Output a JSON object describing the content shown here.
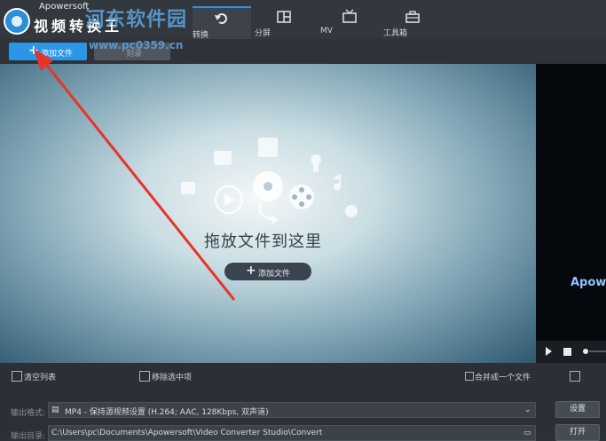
{
  "header": {
    "brand": "Apowersoft",
    "app_title": "视频转换王",
    "watermark_title": "河东软件园",
    "watermark_url": "www.pc0359.cn"
  },
  "tabs": [
    {
      "label": "转换",
      "icon": "refresh-icon",
      "active": true
    },
    {
      "label": "分屏",
      "icon": "split-screen-icon",
      "active": false
    },
    {
      "label": "MV",
      "icon": "tv-icon",
      "active": false
    },
    {
      "label": "工具箱",
      "icon": "toolbox-icon",
      "active": false
    }
  ],
  "toolbar": {
    "add_file": "添加文件",
    "add_file_secondary": "刻录"
  },
  "dropzone": {
    "hint": "拖放文件到这里",
    "add_file": "添加文件"
  },
  "preview": {
    "text": "Apow"
  },
  "bottom": {
    "clear_list": "清空列表",
    "remove_selected": "移除选中项",
    "merge": "合并成一个文件",
    "output_format_label": "输出格式:",
    "output_format_value": "MP4 - 保持源视频设置 (H.264; AAC, 128Kbps, 双声道)",
    "settings_button": "设置",
    "output_dir_label": "输出目录:",
    "output_dir_value": "C:\\Users\\pc\\Documents\\Apowersoft\\Video Converter Studio\\Convert",
    "open_button": "打开"
  },
  "colors": {
    "accent": "#2b95e6",
    "annotation_arrow": "#e8332a"
  }
}
